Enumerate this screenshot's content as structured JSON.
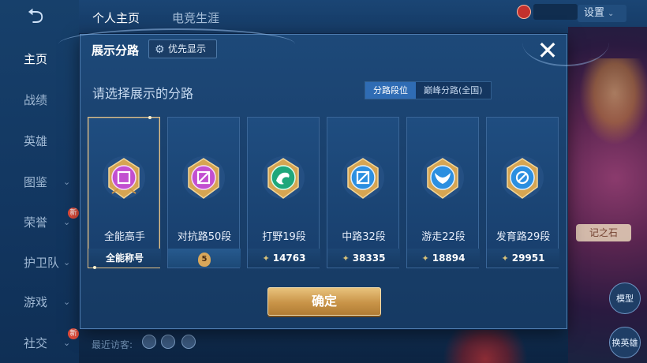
{
  "sidebar": {
    "items": [
      {
        "label": "主页",
        "active": true,
        "has_chevron": false
      },
      {
        "label": "战绩",
        "active": false,
        "has_chevron": false
      },
      {
        "label": "英雄",
        "active": false,
        "has_chevron": false
      },
      {
        "label": "图鉴",
        "active": false,
        "has_chevron": true
      },
      {
        "label": "荣誉",
        "active": false,
        "has_chevron": true,
        "badge": "新"
      },
      {
        "label": "护卫队",
        "active": false,
        "has_chevron": true
      },
      {
        "label": "游戏",
        "active": false,
        "has_chevron": true
      },
      {
        "label": "社交",
        "active": false,
        "has_chevron": true,
        "badge": "新"
      }
    ]
  },
  "top_tabs": [
    {
      "label": "个人主页",
      "active": true
    },
    {
      "label": "电竞生涯",
      "active": false
    }
  ],
  "settings_label": "设置",
  "visitors_label": "最近访客:",
  "right_panel": {
    "bubble": "记之石",
    "button_1": "模型",
    "button_2": "换英雄"
  },
  "modal": {
    "title": "展示分路",
    "priority_button": "优先显示",
    "subtitle": "请选择展示的分路",
    "segments": [
      {
        "label": "分路段位",
        "active": true
      },
      {
        "label": "巅峰分路(全国)",
        "active": false
      }
    ],
    "cards": [
      {
        "label": "全能高手",
        "footer": "全能称号",
        "footer_type": "title",
        "selected": true,
        "emblem": "purple-square-emblem-icon",
        "color": "#c24fd0"
      },
      {
        "label": "对抗路50段",
        "footer": "5",
        "footer_type": "rank",
        "selected": false,
        "emblem": "purple-crossed-emblem-icon",
        "color": "#c24fd0"
      },
      {
        "label": "打野19段",
        "footer": "14763",
        "footer_type": "points",
        "selected": false,
        "emblem": "green-dragon-emblem-icon",
        "color": "#1fa77b"
      },
      {
        "label": "中路32段",
        "footer": "38335",
        "footer_type": "points",
        "selected": false,
        "emblem": "blue-slash-emblem-icon",
        "color": "#2c8fe0"
      },
      {
        "label": "游走22段",
        "footer": "18894",
        "footer_type": "points",
        "selected": false,
        "emblem": "blue-wings-emblem-icon",
        "color": "#2c8fe0"
      },
      {
        "label": "发育路29段",
        "footer": "29951",
        "footer_type": "points",
        "selected": false,
        "emblem": "blue-target-emblem-icon",
        "color": "#2c8fe0"
      }
    ],
    "confirm_label": "确定"
  },
  "colors": {
    "gold": "#e5c287",
    "panel_bg": "#1d4979",
    "segment_active": "#2f6cb4"
  }
}
